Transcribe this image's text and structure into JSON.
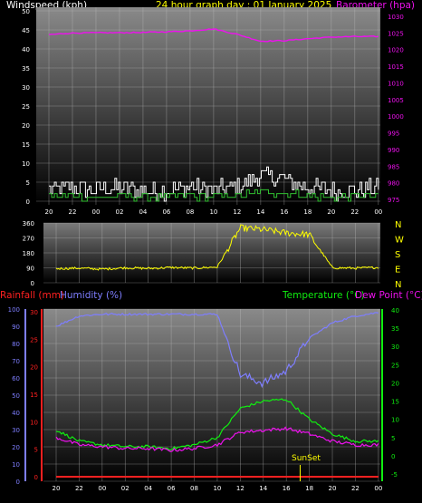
{
  "header": {
    "windspeed_label": "Windspeed (kph)",
    "title": "24 hour graph day : 01 January 2025",
    "barometer_label": "Barometer (hpa)"
  },
  "colors": {
    "background": "#000000",
    "windspeed": "#ffffff",
    "gust": "#ffffff",
    "wind_avg": "#30c030",
    "barometer": "#ee11ee",
    "direction": "#ffff00",
    "rainfall": "#ff2020",
    "humidity": "#7e7eff",
    "temperature": "#10ee10",
    "dewpoint": "#ee11ee",
    "header_title": "#ffff00",
    "sunset": "#ffff00"
  },
  "time_ticks": [
    "20",
    "22",
    "00",
    "02",
    "04",
    "06",
    "08",
    "10",
    "12",
    "14",
    "16",
    "18",
    "20",
    "22",
    "00"
  ],
  "panel1": {
    "wind_ticks": [
      "50",
      "45",
      "40",
      "35",
      "30",
      "25",
      "20",
      "15",
      "10",
      "5",
      "0"
    ],
    "baro_ticks": [
      "1030",
      "1025",
      "1020",
      "1015",
      "1010",
      "1005",
      "1000",
      "995",
      "990",
      "985",
      "980",
      "975"
    ]
  },
  "panel2": {
    "dir_ticks": [
      "360",
      "270",
      "180",
      "90",
      "0"
    ],
    "compass": [
      "N",
      "W",
      "S",
      "E",
      "N"
    ]
  },
  "panel3": {
    "rainfall_label": "Rainfall (mm)",
    "humidity_label": "Humidity (%)",
    "temperature_label": "Temperature (°C)",
    "dewpoint_label": "Dew Point (°C)",
    "humidity_ticks": [
      "100",
      "90",
      "80",
      "70",
      "60",
      "50",
      "40",
      "30",
      "20",
      "10",
      "0"
    ],
    "rain_ticks": [
      "30",
      "25",
      "20",
      "15",
      "10",
      "5",
      "0"
    ],
    "temp_ticks": [
      "40",
      "35",
      "30",
      "25",
      "20",
      "15",
      "10",
      "5",
      "0",
      "-5"
    ],
    "sunset_label": "SunSet"
  },
  "chart_data": [
    {
      "type": "line",
      "x": [
        "20",
        "22",
        "00",
        "02",
        "04",
        "06",
        "08",
        "10",
        "12",
        "14",
        "16",
        "18",
        "20",
        "22",
        "00"
      ],
      "ylim": [
        0,
        50
      ],
      "y2lim": [
        973,
        1031
      ],
      "series": [
        {
          "name": "Windspeed (kph)",
          "values": [
            3,
            4,
            3,
            4,
            3,
            3,
            4,
            3,
            4,
            7,
            6,
            4,
            3,
            3,
            4
          ]
        },
        {
          "name": "Barometer (hpa)",
          "axis": "right",
          "values": [
            1025.2,
            1025.7,
            1025.8,
            1025.8,
            1025.9,
            1026.1,
            1026.4,
            1027.0,
            1025.3,
            1023.1,
            1023.3,
            1023.9,
            1024.4,
            1024.6,
            1024.6
          ]
        }
      ]
    },
    {
      "type": "line",
      "x": [
        "20",
        "22",
        "00",
        "02",
        "04",
        "06",
        "08",
        "10",
        "12",
        "14",
        "16",
        "18",
        "20",
        "22",
        "00"
      ],
      "ylim": [
        0,
        360
      ],
      "series": [
        {
          "name": "Wind direction",
          "values": [
            85,
            88,
            82,
            90,
            86,
            92,
            88,
            95,
            330,
            320,
            300,
            290,
            90,
            88,
            92
          ]
        }
      ]
    },
    {
      "type": "line",
      "x": [
        "20",
        "22",
        "00",
        "02",
        "04",
        "06",
        "08",
        "10",
        "12",
        "14",
        "16",
        "18",
        "20",
        "22",
        "00"
      ],
      "ylim": [
        0,
        100
      ],
      "series": [
        {
          "name": "Rainfall (mm)",
          "axis": "rain",
          "values": [
            0,
            0,
            0,
            0,
            0,
            0,
            0,
            0,
            0,
            0,
            0,
            0,
            0,
            0,
            0
          ]
        },
        {
          "name": "Humidity (%)",
          "values": [
            90,
            96,
            97,
            97,
            97,
            97,
            97,
            97,
            62,
            57,
            64,
            83,
            92,
            96,
            98
          ]
        },
        {
          "name": "Temperature (°C)",
          "axis": "right",
          "values": [
            7,
            4,
            3,
            2.5,
            2.5,
            2,
            3,
            5,
            13,
            15,
            15.5,
            10,
            6,
            4,
            4
          ]
        },
        {
          "name": "Dew Point (°C)",
          "axis": "right",
          "values": [
            5,
            3,
            2.5,
            2,
            2,
            1.5,
            2,
            3,
            6.5,
            7,
            7.5,
            6,
            4,
            3,
            3
          ]
        }
      ]
    }
  ]
}
